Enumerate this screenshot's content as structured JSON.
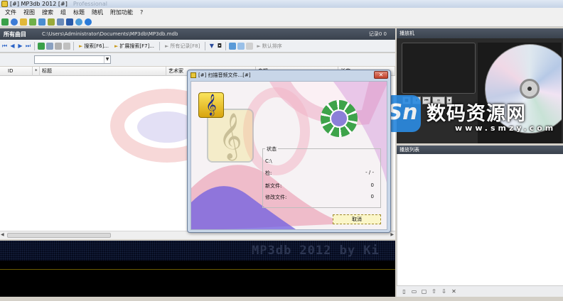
{
  "window": {
    "title": "[#] MP3db 2012 [#]",
    "subtitle_faded": "Professional"
  },
  "menu": [
    "文件",
    "视图",
    "搜索",
    "组",
    "标题",
    "随机",
    "附加功能",
    "?"
  ],
  "library": {
    "title": "所有曲目",
    "path": "C:\\Users\\Administrator\\Documents\\MP3db\\MP3db.mdb",
    "record_count": "记录0 0"
  },
  "lib_toolbar": {
    "search_label": "搜索[F6]...",
    "ext_search_label": "扩展搜索[F7]...",
    "all_records_label": "所有记录[F8]",
    "default_sort_label": "默认排序"
  },
  "grid": {
    "columns": [
      "ID",
      "*",
      "标题",
      "艺术家",
      "专辑",
      "长度"
    ]
  },
  "lcd_text": "MP3db 2012 by Ki",
  "player": {
    "header": "播放机",
    "volume_label": "音",
    "controls": [
      "■",
      "⏸",
      "⏮",
      "∞",
      "▾"
    ]
  },
  "playlist": {
    "header": "播放列表",
    "footer_buttons": [
      "▯",
      "▭",
      "▢",
      "⇧",
      "⇩",
      "✕"
    ]
  },
  "dialog": {
    "title": "[#] 扫描音频文件...[#]",
    "close": "✕",
    "status_legend": "状态",
    "path": "C:\\",
    "rows": [
      {
        "label": "检:",
        "value": "- / -"
      },
      {
        "label": "新文件:",
        "value": "0"
      },
      {
        "label": "修改文件:",
        "value": "0"
      }
    ],
    "cancel_label": "取消"
  },
  "watermark": {
    "logo_letter": "Sn",
    "text": "数码资源网",
    "sub": "www.smzy.com"
  },
  "colors": {
    "header_dark": "#3a424d",
    "spinner_green": "#3ea34a",
    "lcd_bg": "#050a1e"
  }
}
